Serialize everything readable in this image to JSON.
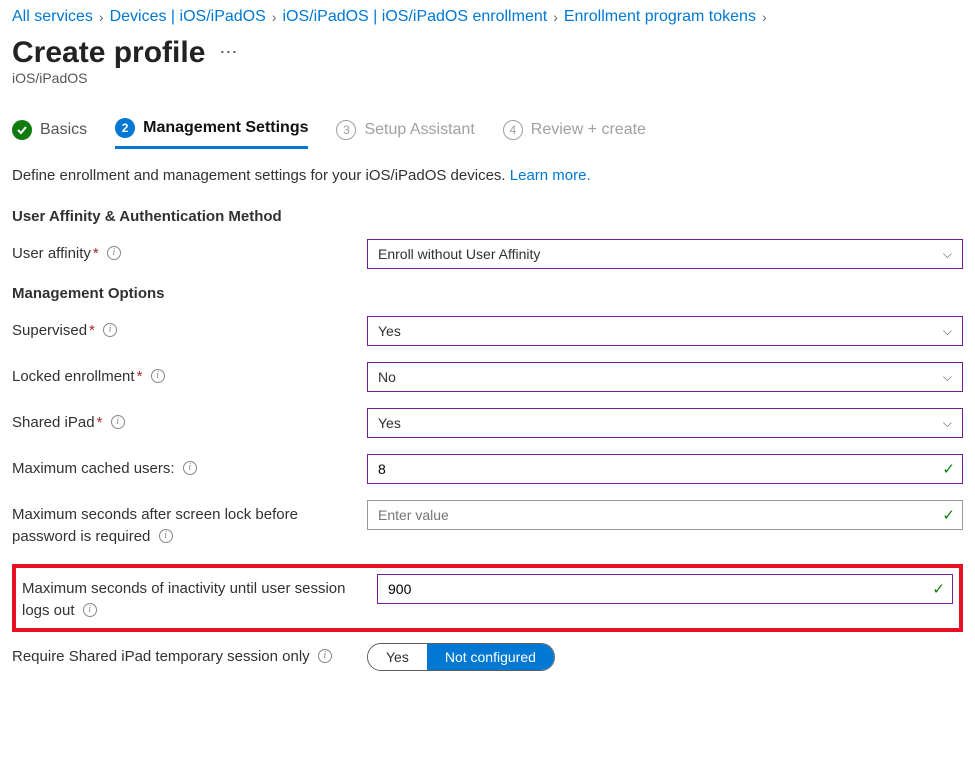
{
  "breadcrumb": {
    "items": [
      "All services",
      "Devices | iOS/iPadOS",
      "iOS/iPadOS | iOS/iPadOS enrollment",
      "Enrollment program tokens"
    ]
  },
  "header": {
    "title": "Create profile",
    "subtitle": "iOS/iPadOS"
  },
  "tabs": {
    "items": [
      {
        "num": "✓",
        "label": "Basics"
      },
      {
        "num": "2",
        "label": "Management Settings"
      },
      {
        "num": "3",
        "label": "Setup Assistant"
      },
      {
        "num": "4",
        "label": "Review + create"
      }
    ]
  },
  "desc": {
    "text": "Define enrollment and management settings for your iOS/iPadOS devices. ",
    "link": "Learn more."
  },
  "section1": {
    "heading": "User Affinity & Authentication Method",
    "user_affinity_label": "User affinity",
    "user_affinity_value": "Enroll without User Affinity"
  },
  "section2": {
    "heading": "Management Options",
    "supervised_label": "Supervised",
    "supervised_value": "Yes",
    "locked_label": "Locked enrollment",
    "locked_value": "No",
    "sharedipad_label": "Shared iPad",
    "sharedipad_value": "Yes",
    "maxcached_label": "Maximum cached users:",
    "maxcached_value": "8",
    "maxseclock_label": "Maximum seconds after screen lock before password is required",
    "maxseclock_placeholder": "Enter value",
    "maxsecinact_label": "Maximum seconds of inactivity until user session logs out",
    "maxsecinact_value": "900",
    "tempsession_label": "Require Shared iPad temporary session only",
    "tempsession_yes": "Yes",
    "tempsession_notconfig": "Not configured"
  }
}
